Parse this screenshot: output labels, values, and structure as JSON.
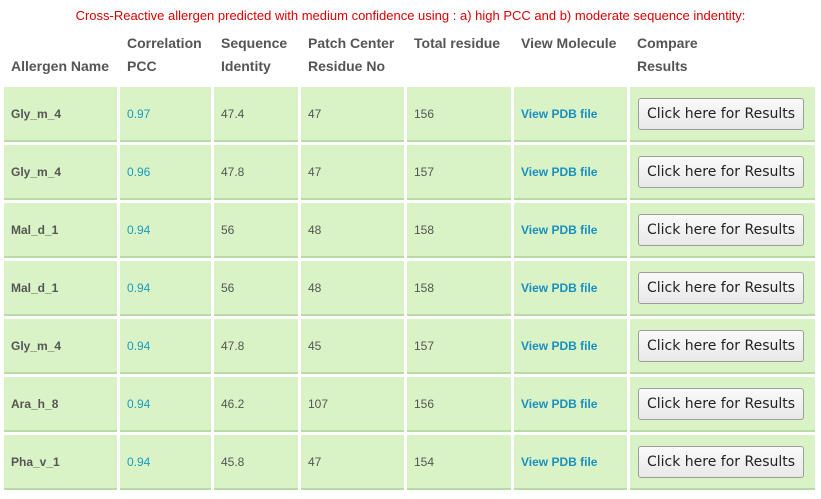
{
  "caption": "Cross-Reactive allergen predicted with medium confidence using : a) high PCC and b) moderate sequence indentity:",
  "headers": {
    "allergen_name": "Allergen Name",
    "correlation_line1": "Correlation",
    "correlation_line2": "PCC",
    "sequence_line1": "Sequence",
    "sequence_line2": "Identity",
    "patch_line1": "Patch Center",
    "patch_line2": "Residue No",
    "total_residue": "Total residue",
    "view_molecule": "View Molecule",
    "compare_line1": "Compare",
    "compare_line2": "Results"
  },
  "rows": [
    {
      "name": "Gly_m_4",
      "pcc": "0.97",
      "identity": "47.4",
      "patch": "47",
      "total": "156",
      "link": "View PDB file",
      "button": "Click here for Results"
    },
    {
      "name": "Gly_m_4",
      "pcc": "0.96",
      "identity": "47.8",
      "patch": "47",
      "total": "157",
      "link": "View PDB file",
      "button": "Click here for Results"
    },
    {
      "name": "Mal_d_1",
      "pcc": "0.94",
      "identity": "56",
      "patch": "48",
      "total": "158",
      "link": "View PDB file",
      "button": "Click here for Results"
    },
    {
      "name": "Mal_d_1",
      "pcc": "0.94",
      "identity": "56",
      "patch": "48",
      "total": "158",
      "link": "View PDB file",
      "button": "Click here for Results"
    },
    {
      "name": "Gly_m_4",
      "pcc": "0.94",
      "identity": "47.8",
      "patch": "45",
      "total": "157",
      "link": "View PDB file",
      "button": "Click here for Results"
    },
    {
      "name": "Ara_h_8",
      "pcc": "0.94",
      "identity": "46.2",
      "patch": "107",
      "total": "156",
      "link": "View PDB file",
      "button": "Click here for Results"
    },
    {
      "name": "Pha_v_1",
      "pcc": "0.94",
      "identity": "45.8",
      "patch": "47",
      "total": "154",
      "link": "View PDB file",
      "button": "Click here for Results"
    }
  ]
}
